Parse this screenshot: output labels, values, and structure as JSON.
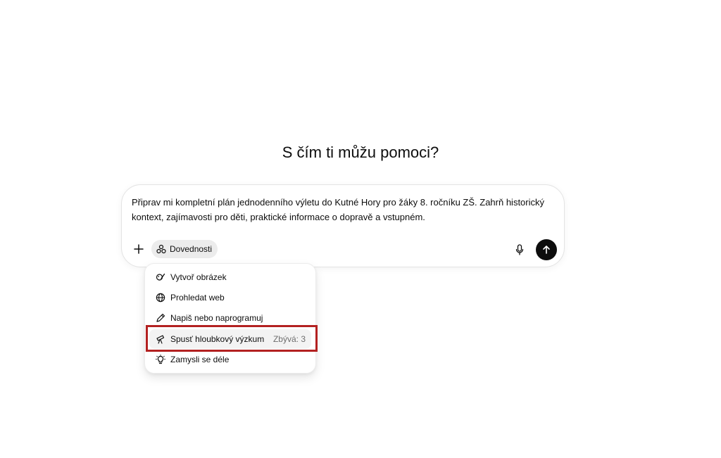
{
  "heading": "S čím ti můžu pomoci?",
  "composer": {
    "prompt_text": "Připrav mi kompletní plán jednodenního výletu do Kutné Hory pro žáky 8. ročníku ZŠ. Zahrň historický kontext, zajímavosti pro děti, praktické informace o dopravě a vstupném.",
    "skills_label": "Dovednosti"
  },
  "menu": {
    "items": [
      {
        "label": "Vytvoř obrázek",
        "icon": "image-brush-icon"
      },
      {
        "label": "Prohledat web",
        "icon": "globe-icon"
      },
      {
        "label": "Napiš nebo naprogramuj",
        "icon": "pen-icon"
      },
      {
        "label": "Spusť hloubkový výzkum",
        "icon": "telescope-icon",
        "count": "Zbývá: 3"
      },
      {
        "label": "Zamysli se déle",
        "icon": "lightbulb-icon"
      }
    ]
  },
  "colors": {
    "highlight": "#b32121",
    "send_button": "#0d0d0d",
    "skills_chip": "#ececec"
  }
}
